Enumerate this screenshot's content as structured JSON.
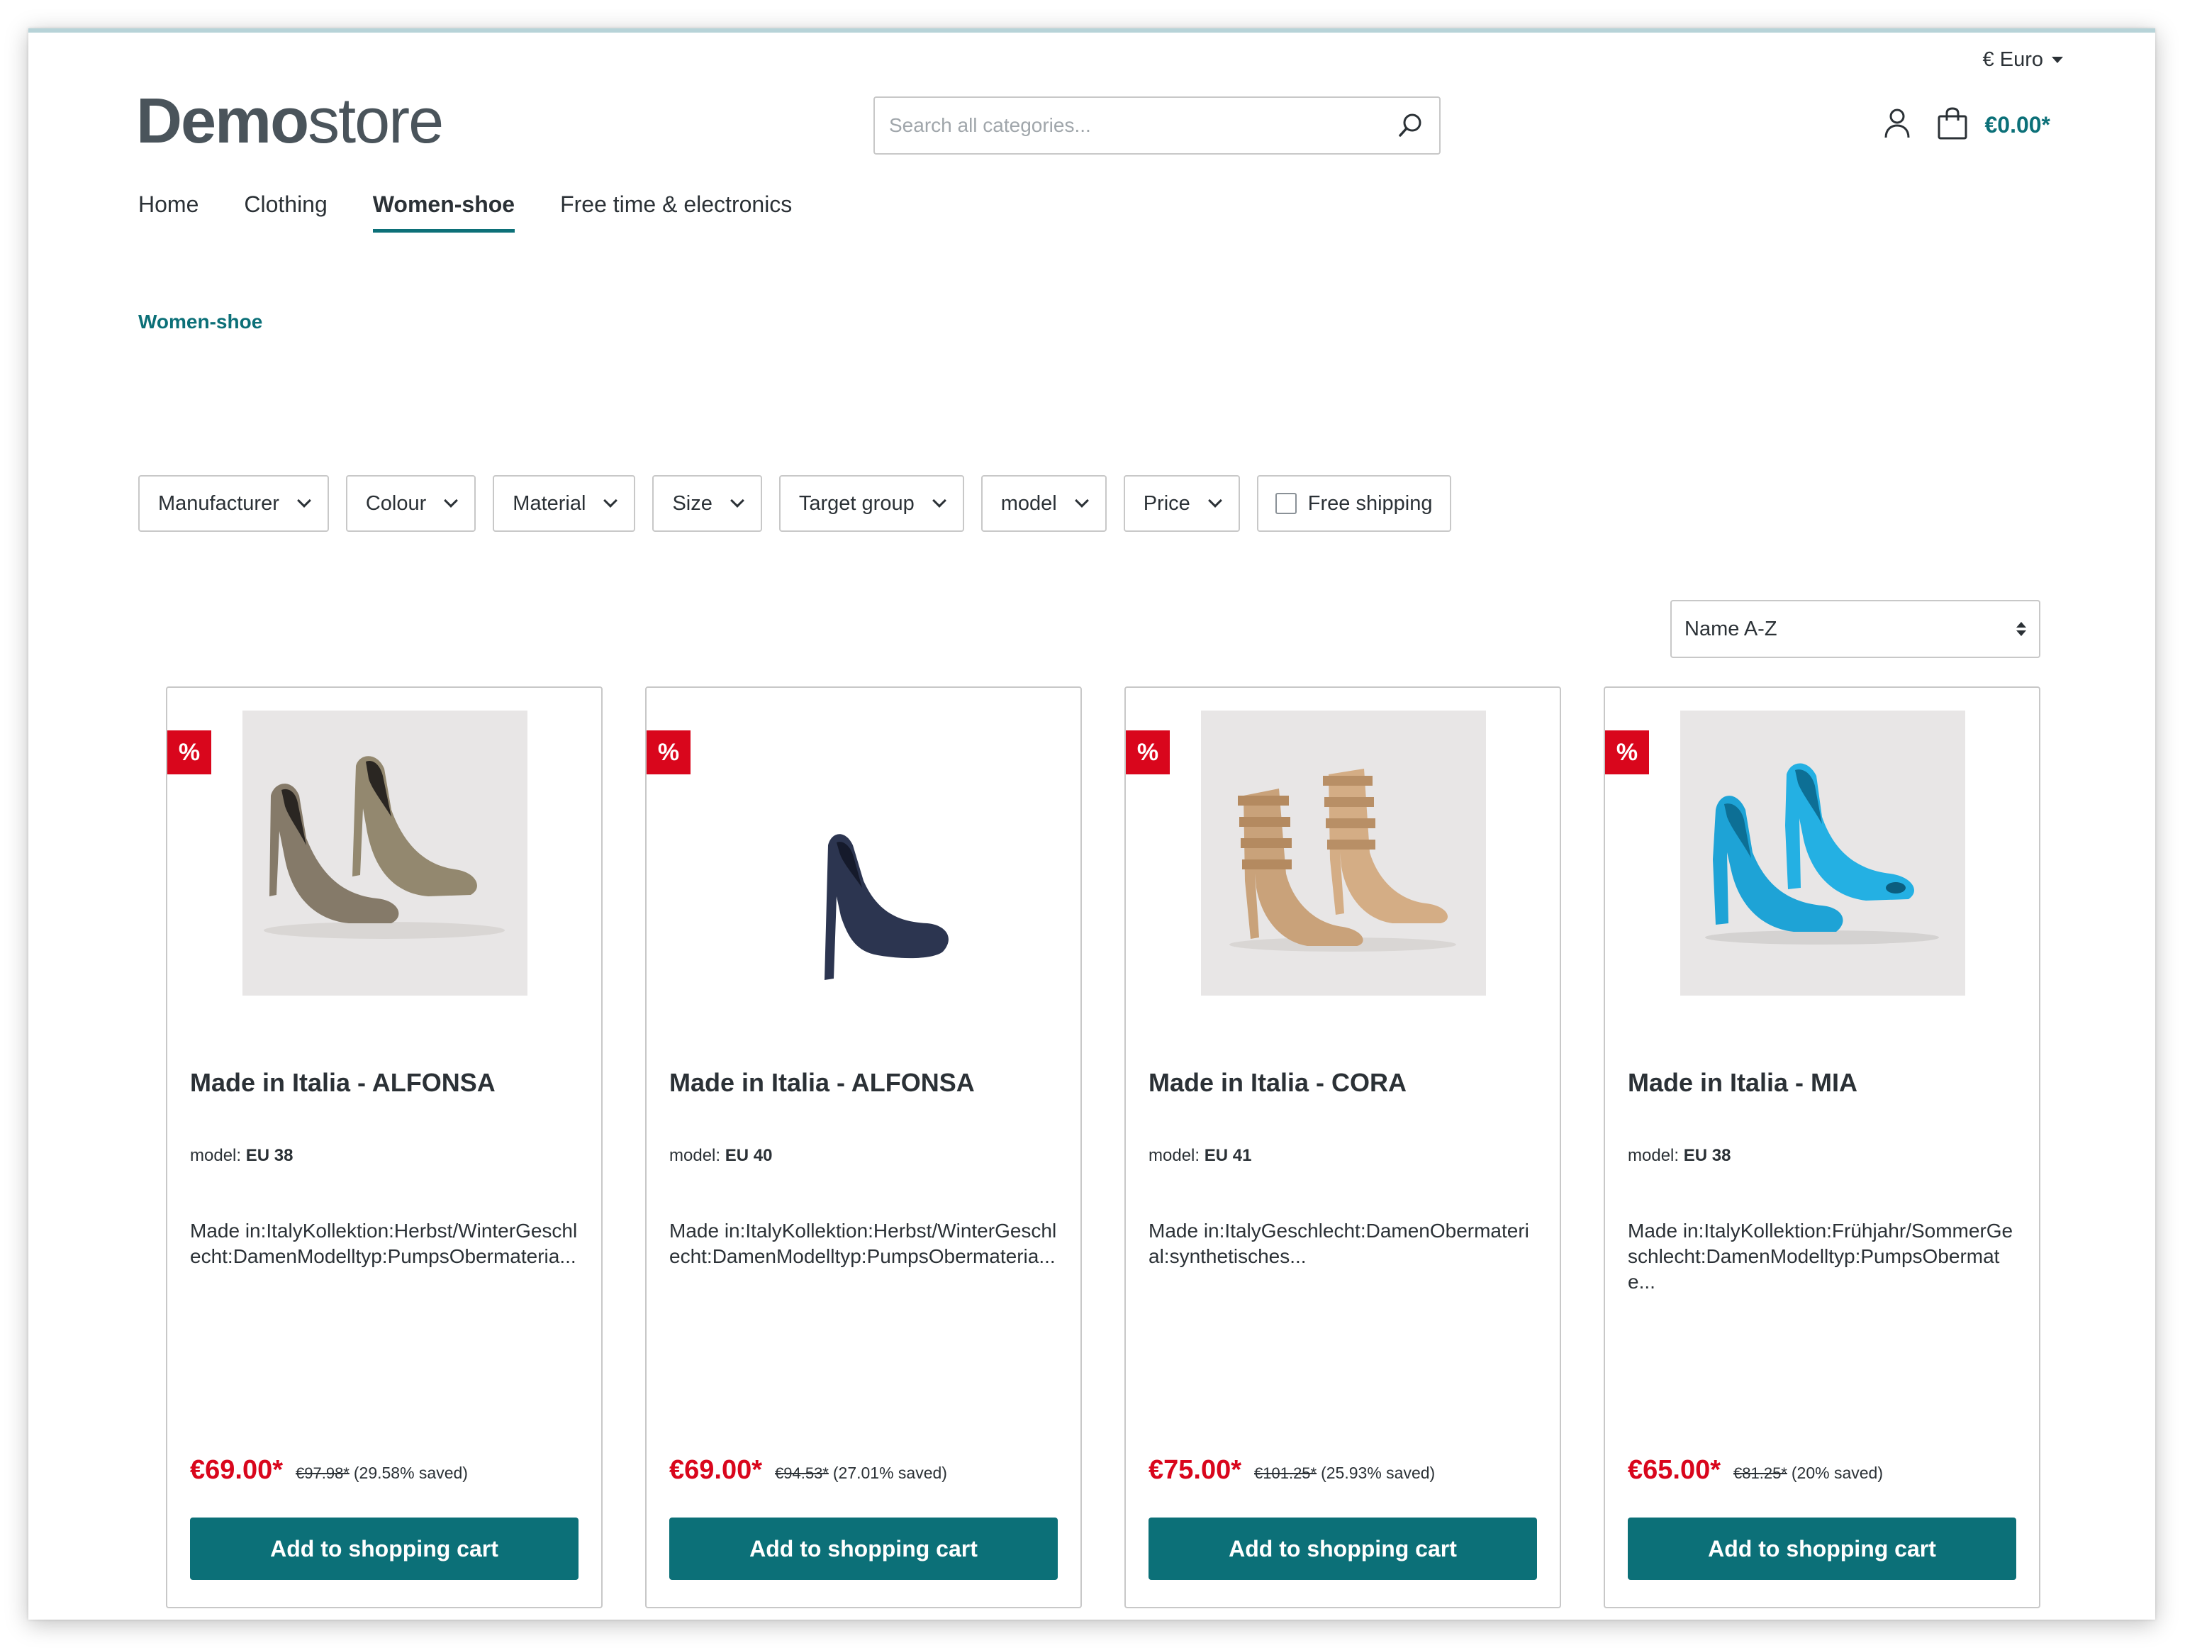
{
  "header": {
    "currency": "€ Euro",
    "logo_bold": "Demo",
    "logo_light": "store",
    "search_placeholder": "Search all categories...",
    "cart_total": "€0.00*"
  },
  "nav": {
    "items": [
      {
        "label": "Home"
      },
      {
        "label": "Clothing"
      },
      {
        "label": "Women-shoe"
      },
      {
        "label": "Free time & electronics"
      }
    ],
    "active": "Women-shoe"
  },
  "breadcrumb": "Women-shoe",
  "filters": [
    {
      "label": "Manufacturer"
    },
    {
      "label": "Colour"
    },
    {
      "label": "Material"
    },
    {
      "label": "Size"
    },
    {
      "label": "Target group"
    },
    {
      "label": "model"
    },
    {
      "label": "Price"
    }
  ],
  "free_shipping_label": "Free shipping",
  "sort": {
    "selected": "Name A-Z"
  },
  "products": [
    {
      "badge": "%",
      "name": "Made in Italia - ALFONSA",
      "model_label": "model:",
      "model_value": "EU 38",
      "description": "Made in:ItalyKollektion:Herbst/WinterGeschlecht:DamenModelltyp:PumpsObermateria...",
      "price": "€69.00*",
      "old_price": "€97.98*",
      "saved": "(29.58% saved)",
      "button": "Add to shopping cart",
      "image_icon": "taupe-suede-pumps-image",
      "color": "#8a7f6e"
    },
    {
      "badge": "%",
      "name": "Made in Italia - ALFONSA",
      "model_label": "model:",
      "model_value": "EU 40",
      "description": "Made in:ItalyKollektion:Herbst/WinterGeschlecht:DamenModelltyp:PumpsObermateria...",
      "price": "€69.00*",
      "old_price": "€94.53*",
      "saved": "(27.01% saved)",
      "button": "Add to shopping cart",
      "image_icon": "navy-pump-image",
      "color": "#2c3550"
    },
    {
      "badge": "%",
      "name": "Made in Italia - CORA",
      "model_label": "model:",
      "model_value": "EU 41",
      "description": "Made in:ItalyGeschlecht:DamenObermaterial:synthetisches...",
      "price": "€75.00*",
      "old_price": "€101.25*",
      "saved": "(25.93% saved)",
      "button": "Add to shopping cart",
      "image_icon": "beige-strappy-heels-image",
      "color": "#c9a27a"
    },
    {
      "badge": "%",
      "name": "Made in Italia - MIA",
      "model_label": "model:",
      "model_value": "EU 38",
      "description": "Made in:ItalyKollektion:Frühjahr/SommerGeschlecht:DamenModelltyp:PumpsObermate...",
      "price": "€65.00*",
      "old_price": "€81.25*",
      "saved": "(20% saved)",
      "button": "Add to shopping cart",
      "image_icon": "blue-peep-toe-pumps-image",
      "color": "#1ea3d6"
    }
  ],
  "colors": {
    "accent": "#0c7078",
    "sale_red": "#d9061c",
    "text": "#2b3136"
  }
}
